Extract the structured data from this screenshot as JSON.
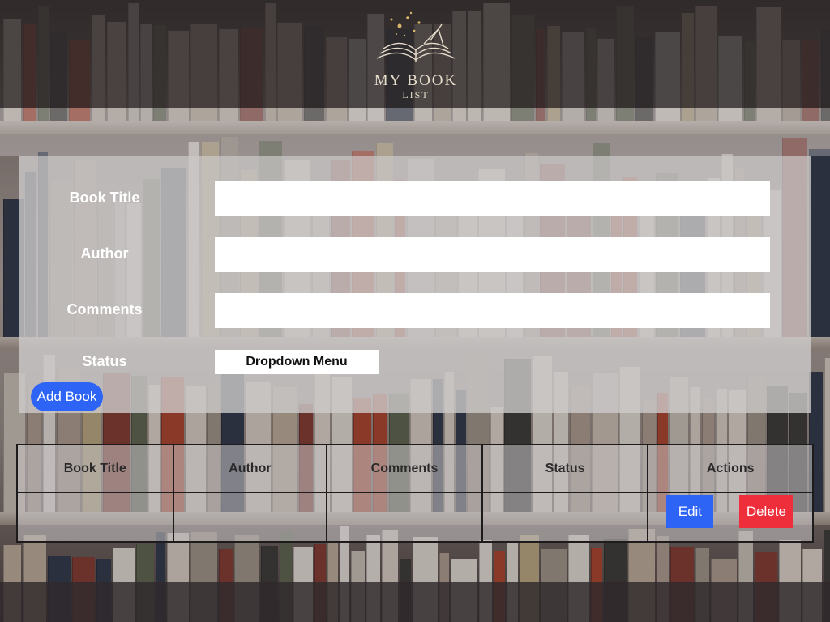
{
  "header": {
    "logo_title": "MY BOOK",
    "logo_subtitle": "LIST"
  },
  "form": {
    "title_label": "Book Title",
    "title_value": "",
    "author_label": "Author",
    "author_value": "",
    "comments_label": "Comments",
    "comments_value": "",
    "status_label": "Status",
    "status_dropdown": "Dropdown Menu",
    "add_button": "Add Book"
  },
  "table": {
    "columns": [
      "Book Title",
      "Author",
      "Comments",
      "Status",
      "Actions"
    ],
    "rows": [
      {
        "title": "",
        "author": "",
        "comments": "",
        "status": "",
        "edit_label": "Edit",
        "delete_label": "Delete"
      }
    ]
  },
  "colors": {
    "primary_button": "#2e64f5",
    "danger_button": "#ee2e3a",
    "logo_gold": "#e6dccb"
  }
}
